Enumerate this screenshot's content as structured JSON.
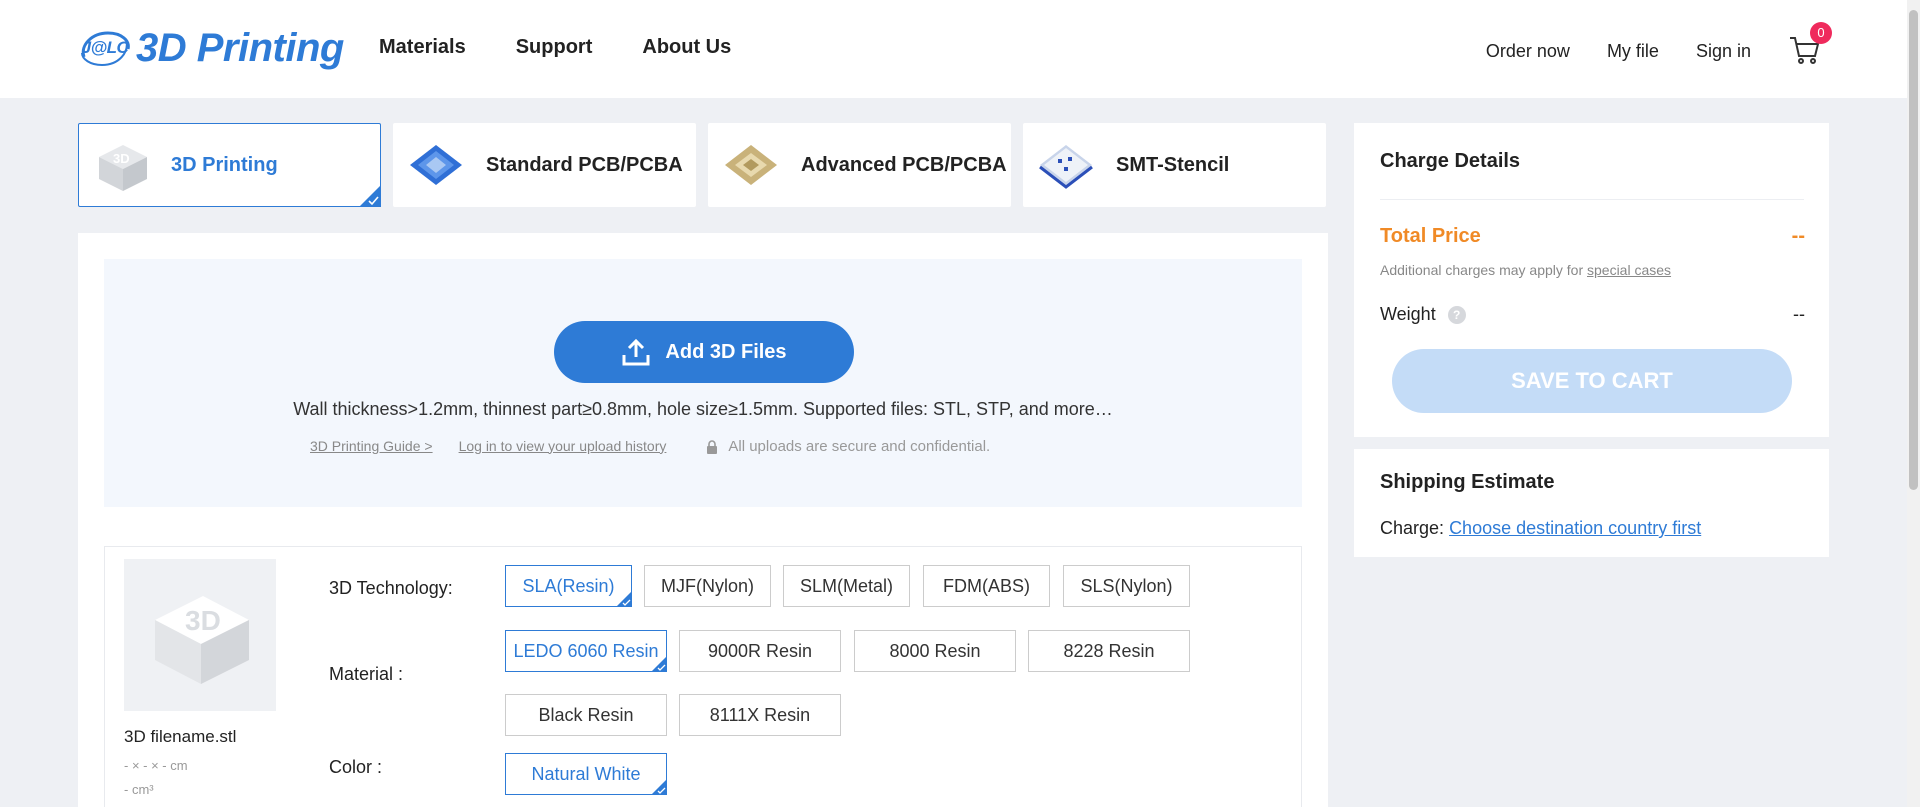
{
  "header": {
    "logo_badge": "J@LC",
    "logo_text": "3D Printing",
    "nav": [
      "Materials",
      "Support",
      "About Us"
    ],
    "order_now": "Order now",
    "my_file": "My file",
    "sign_in": "Sign in",
    "cart_count": "0"
  },
  "tabs": [
    {
      "label": "3D Printing",
      "icon": "3d-cube-icon",
      "active": true
    },
    {
      "label": "Standard PCB/PCBA",
      "icon": "pcb-icon",
      "active": false
    },
    {
      "label": "Advanced PCB/PCBA",
      "icon": "chip-icon",
      "active": false
    },
    {
      "label": "SMT-Stencil",
      "icon": "stencil-icon",
      "active": false
    }
  ],
  "upload": {
    "button_label": "Add 3D Files",
    "hint": "Wall thickness>1.2mm, thinnest part≥0.8mm, hole size≥1.5mm. Supported files: STL, STP, and more…",
    "guide_link": "3D Printing Guide >",
    "history_link": "Log in to view your upload history",
    "secure_text": "All uploads are secure and confidential."
  },
  "part": {
    "file_name": "3D filename.stl",
    "dimensions": "- × - × - cm",
    "volume": "- cm³"
  },
  "options": {
    "technology_label": "3D Technology:",
    "technologies": [
      "SLA(Resin)",
      "MJF(Nylon)",
      "SLM(Metal)",
      "FDM(ABS)",
      "SLS(Nylon)"
    ],
    "material_label": "Material :",
    "materials": [
      "LEDO 6060 Resin",
      "9000R Resin",
      "8000 Resin",
      "8228 Resin",
      "Black Resin",
      "8111X Resin"
    ],
    "color_label": "Color :",
    "colors": [
      "Natural White"
    ]
  },
  "charge": {
    "title": "Charge Details",
    "total_label": "Total Price",
    "total_value": "--",
    "note_prefix": "Additional charges may apply for ",
    "note_link": "special cases",
    "weight_label": "Weight",
    "weight_value": "--",
    "save_button": "SAVE TO CART"
  },
  "shipping": {
    "title": "Shipping Estimate",
    "charge_prefix": "Charge:",
    "charge_link": "Choose destination country first"
  },
  "colors": {
    "accent": "#2e7bd6",
    "price": "#f08a26",
    "badge": "#ef2a5c",
    "save_disabled": "#c4dcf7"
  }
}
